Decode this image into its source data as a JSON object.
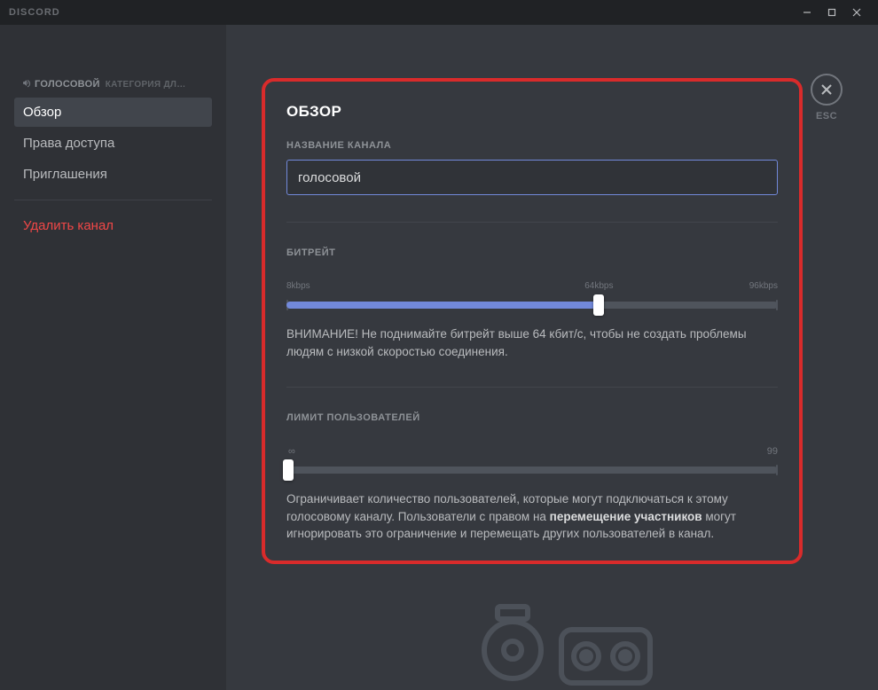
{
  "app": {
    "logo_text": "DISCORD"
  },
  "sidebar": {
    "channel_name": "ГОЛОСОВОЙ",
    "category_suffix": "КАТЕГОРИЯ ДЛ…",
    "items": [
      {
        "label": "Обзор",
        "selected": true
      },
      {
        "label": "Права доступа",
        "selected": false
      },
      {
        "label": "Приглашения",
        "selected": false
      }
    ],
    "delete_label": "Удалить канал"
  },
  "esc": {
    "label": "ESC"
  },
  "panel": {
    "title": "ОБЗОР",
    "channel_name_label": "НАЗВАНИЕ КАНАЛА",
    "channel_name_value": "голосовой",
    "bitrate": {
      "label": "БИТРЕЙТ",
      "min_label": "8kbps",
      "mid_label": "64kbps",
      "max_label": "96kbps",
      "min": 8,
      "mid": 64,
      "max": 96,
      "value": 64,
      "fill_percent": 63.6,
      "warning": "ВНИМАНИЕ! Не поднимайте битрейт выше 64 кбит/с, чтобы не создать проблемы людям с низкой скоростью соединения."
    },
    "user_limit": {
      "label": "ЛИМИТ ПОЛЬЗОВАТЕЛЕЙ",
      "min_label": "∞",
      "max_label": "99",
      "value": 0,
      "fill_percent": 0,
      "help_pre": "Ограничивает количество пользователей, которые могут подключаться к этому голосовому каналу. Пользователи с правом на ",
      "help_bold": "перемещение участников",
      "help_post": " могут игнорировать это ограничение и перемещать других пользователей в канал."
    }
  }
}
